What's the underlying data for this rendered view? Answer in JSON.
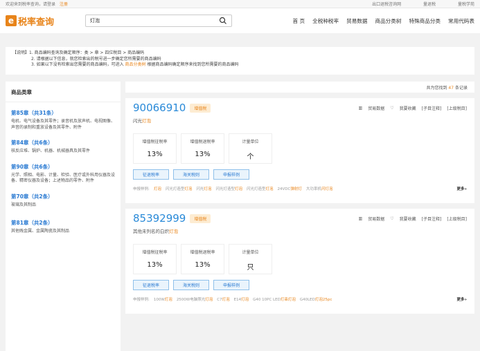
{
  "topbar": {
    "welcome": "欢迎来到税率查询，请登录",
    "register": "注册",
    "links": [
      "出口退税咨询网",
      "量退税",
      "量税学苑"
    ]
  },
  "logo": {
    "mark": "e",
    "text": "税率查询"
  },
  "search": {
    "value": "灯泡"
  },
  "nav": [
    "首 页",
    "全税种税率",
    "贸易数据",
    "商品分类树",
    "特殊商品分类",
    "常用代码表"
  ],
  "notice": {
    "line1": "【说明】1. 商品编码查询及确定顺序：类 > 章 > 四位税目 > 商品编码",
    "line2": "2. 请根据以下信息，就您检索出的税号进一步确定您所需要的商品编码",
    "line3_pre": "3. 如果以下没有检索出您需要的商品编码，可进入 ",
    "line3_link": "商品分类树",
    "line3_post": " 根据商品编码确定顺序来找到您所需要的商品编码"
  },
  "sidebar": {
    "title": "商品类章",
    "chapters": [
      {
        "title": "第85章（共31条）",
        "desc": "电机、电气设备及其零件；录音机及放声机、电视图像、声音的录制和重放设备及其零件、附件"
      },
      {
        "title": "第84章（共6条）",
        "desc": "核反应堆、锅炉、机器、机械器具及其零件"
      },
      {
        "title": "第90章（共6条）",
        "desc": "光学、照相、电影、计量、检验、医疗或外科用仪器及设备、精密仪器及设备；上述物品的零件、附件"
      },
      {
        "title": "第70章（共2条）",
        "desc": "玻璃及其制品"
      },
      {
        "title": "第81章（共2条）",
        "desc": "其他贱金属、金属陶瓷及其制品"
      }
    ]
  },
  "results": {
    "count_pre": "共为您找到",
    "count": "47",
    "count_post": "条记录"
  },
  "cards": [
    {
      "code": "90066910",
      "tag": "增值税",
      "tools": [
        "贸易数据",
        "我要收藏",
        "[子目注释]",
        "[上级税目]"
      ],
      "desc_pre": "闪光",
      "desc_hl": "灯泡",
      "box1_label": "增值税征税率",
      "box1_value": "13%",
      "box2_label": "增值税退税率",
      "box2_value": "13%",
      "box3_label": "计量单位",
      "box3_value": "个",
      "btns": [
        "征退税率",
        "海关税则",
        "申报样例"
      ],
      "examples_label": "申报样例:",
      "examples": [
        {
          "pre": "",
          "hl": "灯泡"
        },
        {
          "pre": "闪光灯造型",
          "hl": "灯泡"
        },
        {
          "pre": "闪光",
          "hl": "灯泡"
        },
        {
          "pre": "闪光灯造型",
          "hl": "灯泡"
        },
        {
          "pre": "闪光灯造型",
          "hl": "灯泡"
        },
        {
          "pre": "24VDC",
          "hl": "弹射灯"
        },
        {
          "pre": "大功率机",
          "hl": "闪灯泡"
        }
      ],
      "more": "更多»"
    },
    {
      "code": "85392999",
      "tag": "增值税",
      "tools": [
        "贸易数据",
        "我要收藏",
        "[子目注释]",
        "[上级税目]"
      ],
      "desc_pre": "其他未列名的白炽",
      "desc_hl": "灯泡",
      "box1_label": "增值税征税率",
      "box1_value": "13%",
      "box2_label": "增值税退税率",
      "box2_value": "13%",
      "box3_label": "计量单位",
      "box3_value": "只",
      "btns": [
        "征退税率",
        "海关税则",
        "申报样例"
      ],
      "examples_label": "申报样例:",
      "examples": [
        {
          "pre": "100W",
          "hl": "灯泡"
        },
        {
          "pre": "2500W电脑照光",
          "hl": "灯泡"
        },
        {
          "pre": "C7",
          "hl": "灯泡"
        },
        {
          "pre": "E14",
          "hl": "灯泡"
        },
        {
          "pre": "G40 10PC LED",
          "hl": "灯串灯泡"
        },
        {
          "pre": "G40LED",
          "hl": "灯泡25pc"
        }
      ],
      "more": "更多»"
    }
  ],
  "colors": {
    "accent": "#e8841a",
    "link": "#2a7ad2"
  }
}
